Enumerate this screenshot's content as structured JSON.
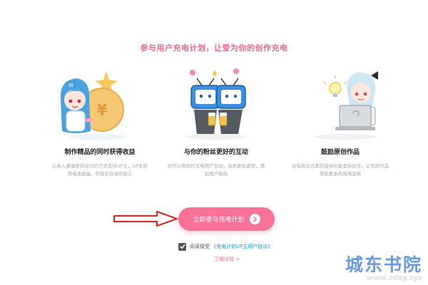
{
  "headline": "参与用户充电计划，让爱为你的创作充电",
  "features": [
    {
      "title": "制作精品的同时获得收益",
      "desc": "让收入遵循更有动力的方式支持UP主，UP主获得电池收益，实现有自身的收入",
      "art": "mascot-with-coin"
    },
    {
      "title": "与你的粉丝更好的互动",
      "desc": "你可以和你的充电用户互动，关系更加紧密，增加用户粘性",
      "art": "two-tv-mascots-cheers"
    },
    {
      "title": "鼓励原创作品",
      "desc": "没有商业元素的支持也能坚持创作，让优质作品得到更多的充电支持",
      "art": "mascot-with-laptop"
    }
  ],
  "cta_label": "立即参与充电计划",
  "agreement": {
    "checked": true,
    "prefix": "阅读接受",
    "link_text": "《充电计划UP主用户协议》"
  },
  "details_link": "了解详情 >",
  "watermark": {
    "title": "城东书院",
    "url": "www.cdsy.xyz"
  },
  "colors": {
    "accent": "#fb7299",
    "headline": "#f06a86",
    "link": "#00a1d6",
    "watermark": "#3a7ad0"
  },
  "icons": [
    "right-arrow-circle-icon",
    "check-icon",
    "red-arrow-annotation"
  ]
}
